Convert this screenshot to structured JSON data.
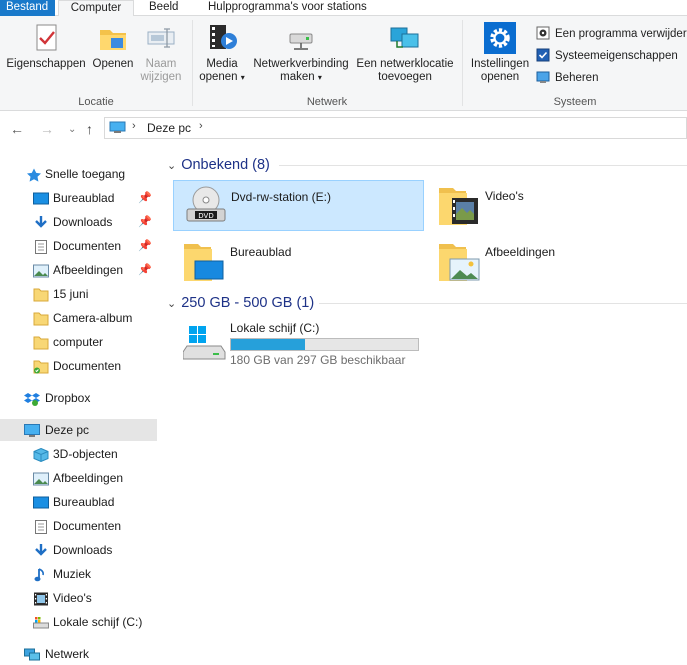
{
  "ribbon": {
    "tabs": [
      {
        "label": "Bestand"
      },
      {
        "label": "Computer"
      },
      {
        "label": "Beeld"
      },
      {
        "label": "Hulpprogramma's voor stations"
      }
    ],
    "groups": {
      "locatie": {
        "label": "Locatie",
        "properties": "Eigenschappen",
        "open": "Openen",
        "rename_line1": "Naam",
        "rename_line2": "wijzigen"
      },
      "netwerk": {
        "label": "Netwerk",
        "media_line1": "Media",
        "media_line2": "openen",
        "map_line1": "Netwerkverbinding",
        "map_line2": "maken",
        "add_line1": "Een netwerklocatie",
        "add_line2": "toevoegen"
      },
      "systeem": {
        "label": "Systeem",
        "settings_line1": "Instellingen",
        "settings_line2": "openen",
        "uninstall": "Een programma verwijderen",
        "sysprops": "Systeemeigenschappen",
        "manage": "Beheren"
      }
    }
  },
  "address": {
    "location": "Deze pc"
  },
  "sidebar": {
    "items": [
      {
        "label": "Snelle toegang",
        "icon": "star-icon"
      },
      {
        "label": "Bureaublad",
        "icon": "desktop-icon",
        "pinned": true
      },
      {
        "label": "Downloads",
        "icon": "download-icon",
        "pinned": true
      },
      {
        "label": "Documenten",
        "icon": "document-icon",
        "pinned": true
      },
      {
        "label": "Afbeeldingen",
        "icon": "pictures-icon",
        "pinned": true
      },
      {
        "label": "15 juni",
        "icon": "folder-icon"
      },
      {
        "label": "Camera-album",
        "icon": "folder-icon"
      },
      {
        "label": "computer",
        "icon": "folder-icon"
      },
      {
        "label": "Documenten",
        "icon": "folder-sync-icon"
      },
      {
        "label": "Dropbox",
        "icon": "dropbox-icon"
      },
      {
        "label": "Deze pc",
        "icon": "pc-icon"
      },
      {
        "label": "3D-objecten",
        "icon": "3d-objects-icon"
      },
      {
        "label": "Afbeeldingen",
        "icon": "pictures-icon"
      },
      {
        "label": "Bureaublad",
        "icon": "desktop-icon"
      },
      {
        "label": "Documenten",
        "icon": "document-icon"
      },
      {
        "label": "Downloads",
        "icon": "download-icon"
      },
      {
        "label": "Muziek",
        "icon": "music-icon"
      },
      {
        "label": "Video's",
        "icon": "video-icon"
      },
      {
        "label": "Lokale schijf (C:)",
        "icon": "drive-icon"
      },
      {
        "label": "Netwerk",
        "icon": "network-icon"
      }
    ]
  },
  "content": {
    "sections": [
      {
        "title": "Onbekend (8)"
      },
      {
        "title": "250 GB - 500 GB (1)"
      }
    ],
    "tiles": [
      {
        "name": "Dvd-rw-station (E:)",
        "icon": "dvd-drive-icon"
      },
      {
        "name": "Video's",
        "icon": "videos-folder-icon"
      },
      {
        "name": "Bureaublad",
        "icon": "desktop-folder-icon"
      },
      {
        "name": "Afbeeldingen",
        "icon": "pictures-folder-icon"
      }
    ],
    "drive": {
      "name": "Lokale schijf (C:)",
      "free_text": "180 GB van 297 GB beschikbaar",
      "used_fraction": 0.394
    }
  },
  "colors": {
    "accent": "#1979ca",
    "selection": "#cce8ff",
    "section_title": "#1e3287",
    "drive_fill": "#26a0da"
  }
}
